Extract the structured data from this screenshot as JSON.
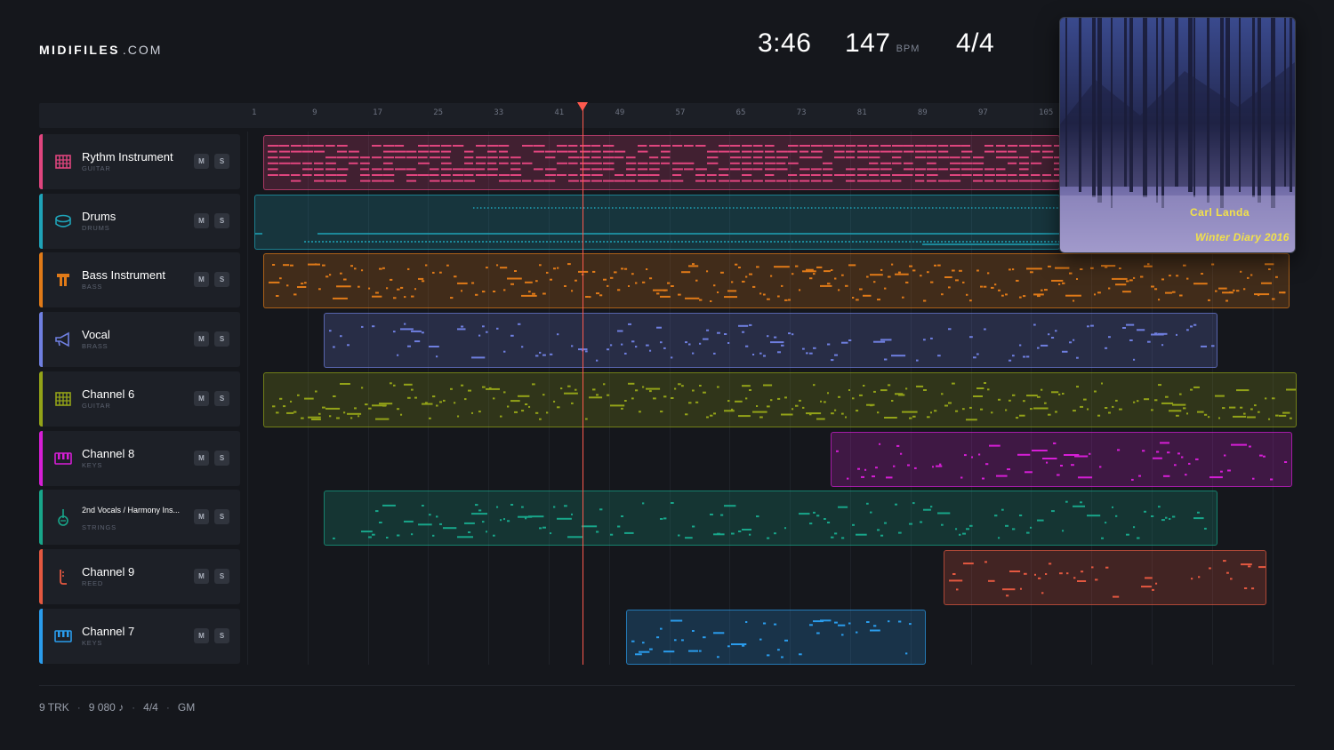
{
  "brand": {
    "name": "MIDIFILES",
    "domain": ".COM"
  },
  "stats": {
    "time": "3:46",
    "bpm": "147",
    "bpm_unit": "BPM",
    "signature": "4/4"
  },
  "ruler": {
    "ticks": [
      "1",
      "9",
      "17",
      "25",
      "33",
      "41",
      "49",
      "57",
      "65",
      "73",
      "81",
      "89",
      "97",
      "105"
    ]
  },
  "playhead": {
    "bar": 45
  },
  "tracks": [
    {
      "name": "Rythm Instrument",
      "category": "GUITAR",
      "mute": "M",
      "solo": "S",
      "color": "#e0457e",
      "icon": "guitar-grid-icon"
    },
    {
      "name": "Drums",
      "category": "DRUMS",
      "mute": "M",
      "solo": "S",
      "color": "#1fa3b8",
      "icon": "drum-icon"
    },
    {
      "name": "Bass Instrument",
      "category": "BASS",
      "mute": "M",
      "solo": "S",
      "color": "#e07a18",
      "icon": "bass-icon"
    },
    {
      "name": "Vocal",
      "category": "BRASS",
      "mute": "M",
      "solo": "S",
      "color": "#6f7fe0",
      "icon": "megaphone-icon"
    },
    {
      "name": "Channel 6",
      "category": "GUITAR",
      "mute": "M",
      "solo": "S",
      "color": "#93a318",
      "icon": "guitar-grid-icon"
    },
    {
      "name": "Channel 8",
      "category": "KEYS",
      "mute": "M",
      "solo": "S",
      "color": "#d61ed6",
      "icon": "keyboard-icon"
    },
    {
      "name": "2nd Vocals / Harmony Ins...",
      "category": "STRINGS",
      "mute": "M",
      "solo": "S",
      "color": "#18a68a",
      "icon": "violin-icon"
    },
    {
      "name": "Channel 9",
      "category": "REED",
      "mute": "M",
      "solo": "S",
      "color": "#e45840",
      "icon": "reed-icon"
    },
    {
      "name": "Channel 7",
      "category": "KEYS",
      "mute": "M",
      "solo": "S",
      "color": "#2a9cec",
      "icon": "keyboard-icon"
    }
  ],
  "album": {
    "artist": "Carl Landa",
    "title": "Winter Diary 2016"
  },
  "footer": {
    "tracks": "9 TRK",
    "notes": "9 080 ♪",
    "signature": "4/4",
    "standard": "GM"
  }
}
